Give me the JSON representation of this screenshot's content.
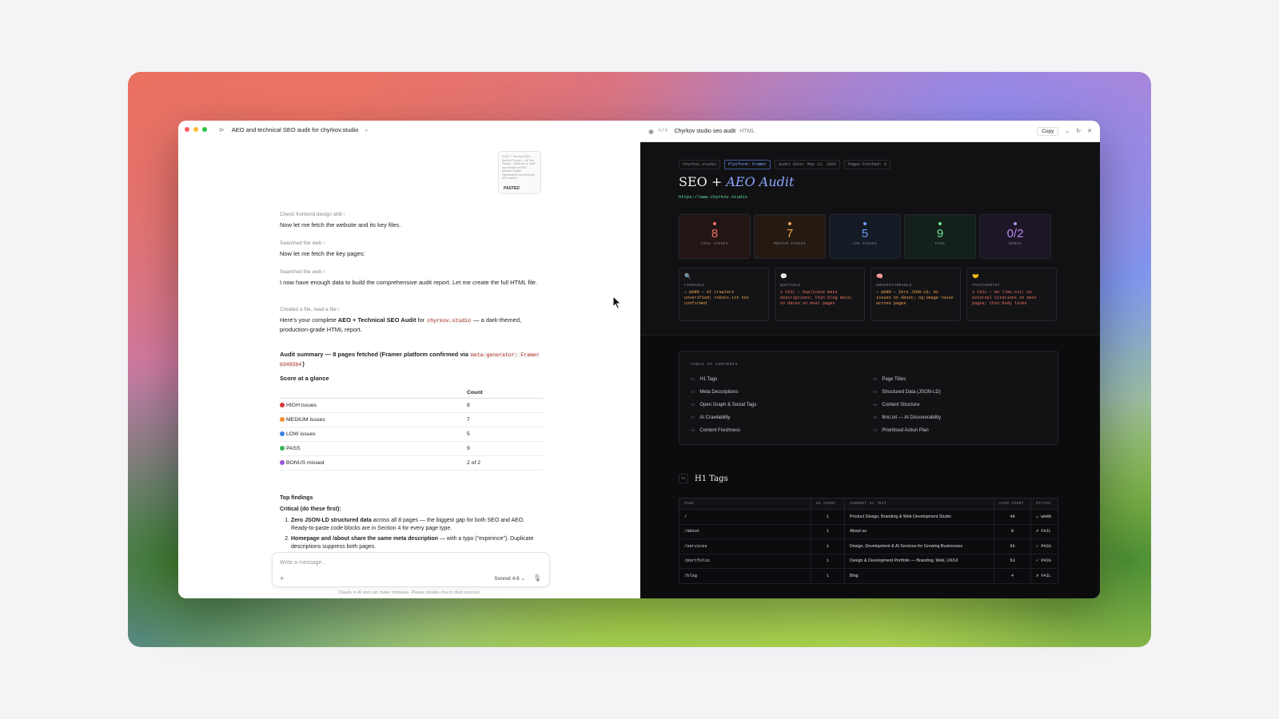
{
  "chat": {
    "title": "AEO and technical SEO audit for chyrkov.studio",
    "pasted_label": "PASTED",
    "pasted_preview": "# AEO + Technical SEO Audit  AI Prompt — All This Prompt - Takes you to audit any website for AEO (Answer Engine Optimization) and technical SEO launch...",
    "steps": [
      {
        "label": "Check frontend design skill",
        "text": "Now let me fetch the website and its key files."
      },
      {
        "label": "Searched the web",
        "text": "Now let me fetch the key pages:"
      },
      {
        "label": "Searched the web",
        "text": "I now have enough data to build the comprehensive audit report. Let me create the full HTML file."
      },
      {
        "label": "Created a file, read a file",
        "text": ""
      }
    ],
    "result_pre": "Here's your complete ",
    "result_bold": "AEO + Technical SEO Audit",
    "result_mid": " for ",
    "result_code": "chyrkov.studio",
    "result_post": " — a dark-themed, production-grade HTML report.",
    "summary_bold": "Audit summary — 8 pages fetched (Framer platform confirmed via ",
    "summary_code": "meta-generator: Framer b3492b4",
    "summary_end": ")",
    "glance_title": "Score at a glance",
    "table_header_count": "Count",
    "score_rows": [
      {
        "icon_color": "#d93a3a",
        "label": "HIGH issues",
        "count": "8"
      },
      {
        "icon_color": "#f08b2e",
        "label": "MEDIUM issues",
        "count": "7"
      },
      {
        "icon_color": "#3a7ee0",
        "label": "LOW issues",
        "count": "5"
      },
      {
        "icon_color": "#35b55a",
        "label": "PASS",
        "count": "9"
      },
      {
        "icon_color": "#9b54d6",
        "label": "BONUS missed",
        "count": "2 of 2"
      }
    ],
    "findings_title": "Top findings",
    "critical_title": "Critical (do these first):",
    "findings": [
      {
        "bold": "Zero JSON-LD structured data",
        "text": " across all 8 pages — the biggest gap for both SEO and AEO. Ready-to-paste code blocks are in Section 4 for every page type."
      },
      {
        "bold": "Homepage and /about share the same meta description",
        "text": " — with a typo (\"experince\"). Duplicate descriptions suppress both pages."
      }
    ],
    "composer_placeholder": "Write a message...",
    "model": "Sonnet 4.6",
    "disclaimer": "Claude is AI and can make mistakes. Please double-check cited sources."
  },
  "artifact": {
    "title": "Chyrkov studio seo audit",
    "kind": "HTML",
    "copy_label": "Copy",
    "chips": [
      "chyrkov.studio",
      "Platform: Framer",
      "Audit Date: May 12, 2026",
      "Pages Fetched: 8"
    ],
    "heading_plain": "SEO + ",
    "heading_italic": "AEO Audit",
    "url": "https://www.chyrkov.studio",
    "stats": [
      {
        "num": "8",
        "label": "HIGH ISSUES",
        "color": "#f07362",
        "bg": "#241515"
      },
      {
        "num": "7",
        "label": "MEDIUM ISSUES",
        "color": "#f0a24d",
        "bg": "#241a12"
      },
      {
        "num": "5",
        "label": "LOW ISSUES",
        "color": "#6f9cf5",
        "bg": "#141a26"
      },
      {
        "num": "9",
        "label": "PASS",
        "color": "#6be49b",
        "bg": "#13211a"
      },
      {
        "num": "0/2",
        "label": "BONUS",
        "color": "#b98af2",
        "bg": "#1c1626"
      }
    ],
    "pillars": [
      {
        "icon": "🔍",
        "label": "FINDABLE",
        "text": "⚠ WARN — AI crawlers unverified; robots.txt not confirmed",
        "color": "#f0a24d"
      },
      {
        "icon": "💬",
        "label": "QUOTABLE",
        "text": "✗ FAIL — Duplicate meta descriptions; thin blog meta; no dates on most pages",
        "color": "#f07362"
      },
      {
        "icon": "🧠",
        "label": "UNDERSTANDABLE",
        "text": "⚠ WARN — Zero JSON-LD; H1 issues on About; og:image reuse across pages",
        "color": "#f0a24d"
      },
      {
        "icon": "🤝",
        "label": "TRUSTWORTHY",
        "text": "✗ FAIL — No llms.txt; no external citations on most pages; thin body links",
        "color": "#f07362"
      }
    ],
    "toc_label": "TABLE OF CONTENTS",
    "toc": [
      {
        "n": "01",
        "label": "H1 Tags"
      },
      {
        "n": "02",
        "label": "Page Titles"
      },
      {
        "n": "03",
        "label": "Meta Descriptions"
      },
      {
        "n": "04",
        "label": "Structured Data (JSON-LD)"
      },
      {
        "n": "05",
        "label": "Open Graph & Social Tags"
      },
      {
        "n": "06",
        "label": "Content Structure"
      },
      {
        "n": "07",
        "label": "AI Crawlability"
      },
      {
        "n": "08",
        "label": "llms.txt — AI Discoverability"
      },
      {
        "n": "09",
        "label": "Content Freshness"
      },
      {
        "n": "10",
        "label": "Prioritised Action Plan"
      }
    ],
    "section_num": "01",
    "section_title": "H1 Tags",
    "table_headers": [
      "PAGE",
      "H1 COUNT",
      "CURRENT H1 TEXT",
      "CHAR COUNT",
      "STATUS"
    ],
    "rows": [
      {
        "page": "/",
        "count": "1",
        "text": "Product Design, Branding & Web Development Studio",
        "chars": "49",
        "status": "⚠ WARN",
        "cls": "warn"
      },
      {
        "page": "/about",
        "count": "1",
        "text": "About us",
        "chars": "8",
        "status": "✗ FAIL",
        "cls": "fail"
      },
      {
        "page": "/services",
        "count": "1",
        "text": "Design, Development & AI Services for Growing Businesses",
        "chars": "56",
        "status": "✓ PASS",
        "cls": "pass"
      },
      {
        "page": "/portfolio",
        "count": "1",
        "text": "Design & Development Portfolio — Branding, Web, UX/UI",
        "chars": "53",
        "status": "✓ PASS",
        "cls": "pass"
      },
      {
        "page": "/blog",
        "count": "1",
        "text": "Blog",
        "chars": "4",
        "status": "✗ FAIL",
        "cls": "fail"
      }
    ]
  }
}
